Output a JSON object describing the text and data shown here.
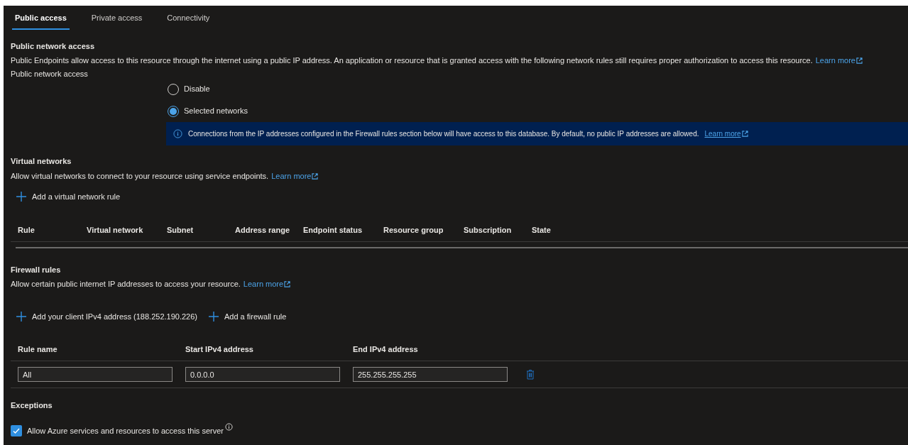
{
  "tabs": [
    {
      "label": "Public access",
      "selected": true
    },
    {
      "label": "Private access",
      "selected": false
    },
    {
      "label": "Connectivity",
      "selected": false
    }
  ],
  "public_network_access": {
    "heading": "Public network access",
    "description": "Public Endpoints allow access to this resource through the internet using a public IP address. An application or resource that is granted access with the following network rules still requires proper authorization to access this resource.",
    "learn_more": "Learn more",
    "field_label": "Public network access",
    "options": [
      {
        "label": "Disable",
        "selected": false
      },
      {
        "label": "Selected networks",
        "selected": true
      }
    ],
    "info": {
      "text": "Connections from the IP addresses configured in the Firewall rules section below will have access to this database. By default, no public IP addresses are allowed.",
      "learn_more": "Learn more"
    }
  },
  "virtual_networks": {
    "heading": "Virtual networks",
    "description": "Allow virtual networks to connect to your resource using service endpoints.",
    "learn_more": "Learn more",
    "actions": [
      "Add a virtual network rule"
    ],
    "columns": [
      "Rule",
      "Virtual network",
      "Subnet",
      "Address range",
      "Endpoint status",
      "Resource group",
      "Subscription",
      "State"
    ]
  },
  "firewall_rules": {
    "heading": "Firewall rules",
    "description": "Allow certain public internet IP addresses to access your resource.",
    "learn_more": "Learn more",
    "actions": [
      "Add your client IPv4 address (188.252.190.226)",
      "Add a firewall rule"
    ],
    "columns": [
      "Rule name",
      "Start IPv4 address",
      "End IPv4 address"
    ],
    "rows": [
      {
        "rule_name": "All",
        "start": "0.0.0.0",
        "end": "255.255.255.255"
      }
    ]
  },
  "exceptions": {
    "heading": "Exceptions",
    "items": [
      {
        "label": "Allow Azure services and resources to access this server",
        "checked": true
      }
    ]
  }
}
